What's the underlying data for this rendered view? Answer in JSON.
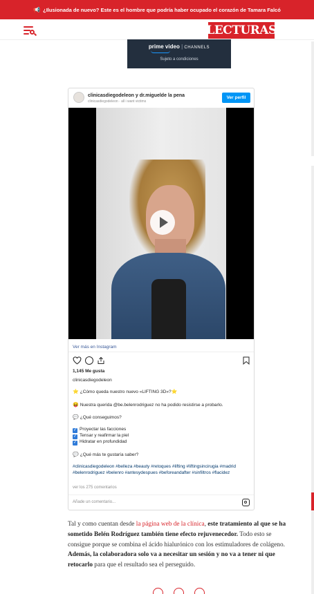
{
  "topbar": {
    "icon": "megaphone-icon",
    "text": "¿Ilusionada de nuevo? Este es el hombre que podría haber ocupado el corazón de Tamara Falcó"
  },
  "header": {
    "logo": "LECTURAS",
    "menu_icon": "menu-search-icon"
  },
  "ad": {
    "brand_prefix": "prime video",
    "channel": "CHANNELS",
    "conditions": "Sujeto a condiciones"
  },
  "instagram": {
    "username": "clinicasdiegodeleon y dr.miguelde la pena",
    "subtitle": "clinicasdiegodeleon · all i want victims",
    "view_profile": "Ver perfil",
    "view_more": "Ver más en Instagram",
    "likes": "1,145 Me gusta",
    "author": "clinicasdiegodeleon",
    "caption_1": "¿Cómo queda nuestro nuevo «LIFTING 3D»?",
    "caption_2": "Nuestra querida @be.belenrodriguez no ha podido resistirse a probarlo.",
    "caption_3": "¿Qué conseguimos?",
    "checklist": [
      "Proyectar las facciones",
      "Tensar y reafirmar la piel",
      "Hidratar en profundidad"
    ],
    "caption_4": "¿Qué más te gustaría saber?",
    "hashtags": "#clinicasdiegodeleon #belleza #beauty #retoques #lifting #liftingsincirugia #madrid #belenrodriguez #belenro #antesydespues #beforeandafter #sinfiltros #flacidez",
    "comments": "ver los 275 comentarios",
    "add_comment": "Añade un comentario..."
  },
  "article": {
    "p1_a": "Tal y como cuentan desde ",
    "p1_link": "la página web de la clínica",
    "p1_b": ", ",
    "p1_bold": "este tratamiento al que se ha sometido Belén Rodríguez también tiene efecto rejuvenecedor.",
    "p1_c": " Todo esto se consigue porque se combina el ácido hialurónico con los estimuladores de colágeno. ",
    "p1_bold2": "Además, la colaboradora solo va a necesitar un sesión y no va a tener ni que retocarlo",
    "p1_d": " para que el resultado sea el perseguido."
  },
  "colors": {
    "brand_red": "#d8232a",
    "instagram_blue": "#0095f6",
    "ad_bg": "#232f3e"
  }
}
